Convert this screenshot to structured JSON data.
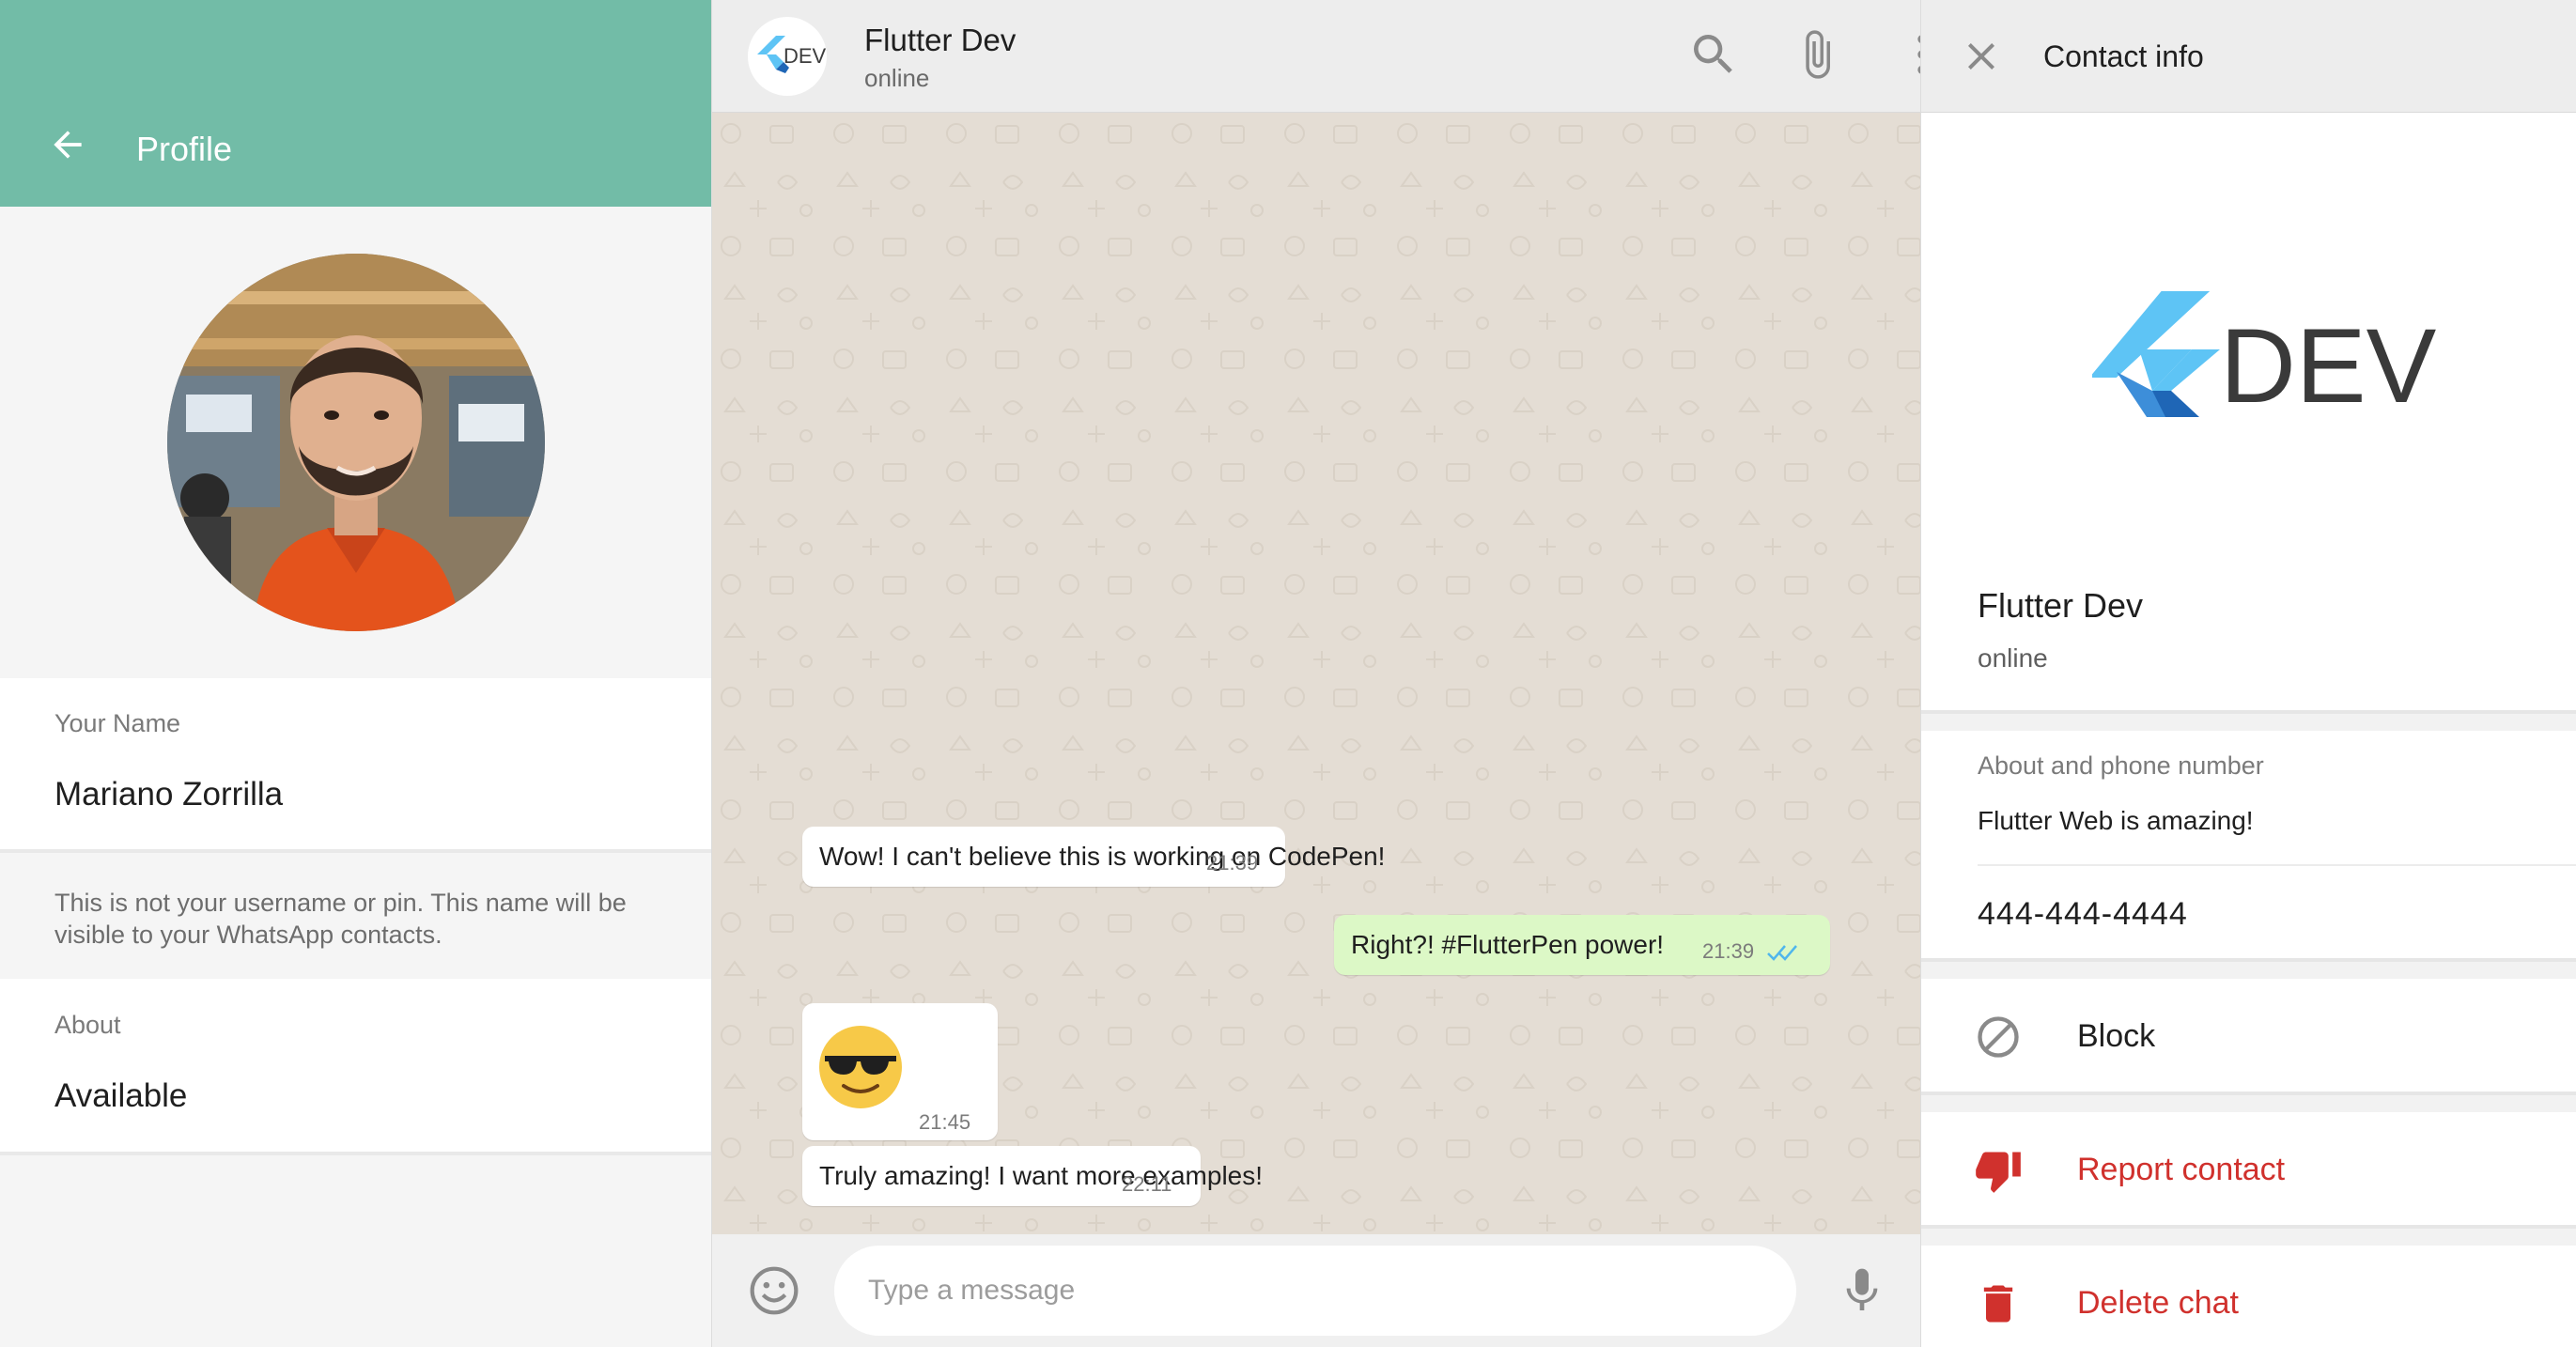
{
  "profile": {
    "title": "Profile",
    "name_label": "Your Name",
    "name_value": "Mariano Zorrilla",
    "name_hint": "This is not your username or pin. This name will be visible to your WhatsApp contacts.",
    "about_label": "About",
    "about_value": "Available"
  },
  "chat": {
    "contact_name": "Flutter Dev",
    "contact_status": "online",
    "avatar_text": "DEV",
    "messages": [
      {
        "text": "Wow! I can't believe this is working on CodePen!",
        "time": "21:39",
        "outgoing": false
      },
      {
        "text": "Right?! #FlutterPen power!",
        "time": "21:39",
        "outgoing": true
      },
      {
        "text": "😎",
        "time": "21:45",
        "outgoing": false
      },
      {
        "text": "Truly amazing! I want more examples!",
        "time": "22:11",
        "outgoing": false
      }
    ],
    "composer_placeholder": "Type a message"
  },
  "contact_info": {
    "title": "Contact info",
    "logo_text": "DEV",
    "name": "Flutter Dev",
    "status": "online",
    "about_label": "About and phone number",
    "about_text": "Flutter Web is amazing!",
    "phone": "444-444-4444",
    "actions": {
      "block": "Block",
      "report": "Report contact",
      "delete": "Delete chat"
    }
  },
  "colors": {
    "header_green": "#72bca7",
    "outgoing_bubble": "#dcf8c6",
    "wallpaper": "#e4ddd4",
    "danger": "#d0312d",
    "read_ticks": "#4fb6ec",
    "flutter_light": "#5ec4f5",
    "flutter_dark": "#1f66b6"
  },
  "icons": {
    "back": "arrow-left-icon",
    "search": "search-icon",
    "attach": "paperclip-icon",
    "menu": "more-vertical-icon",
    "close": "close-icon",
    "emoji": "smiley-icon",
    "mic": "microphone-icon",
    "block": "block-icon",
    "report": "thumbs-down-icon",
    "delete": "trash-icon"
  }
}
